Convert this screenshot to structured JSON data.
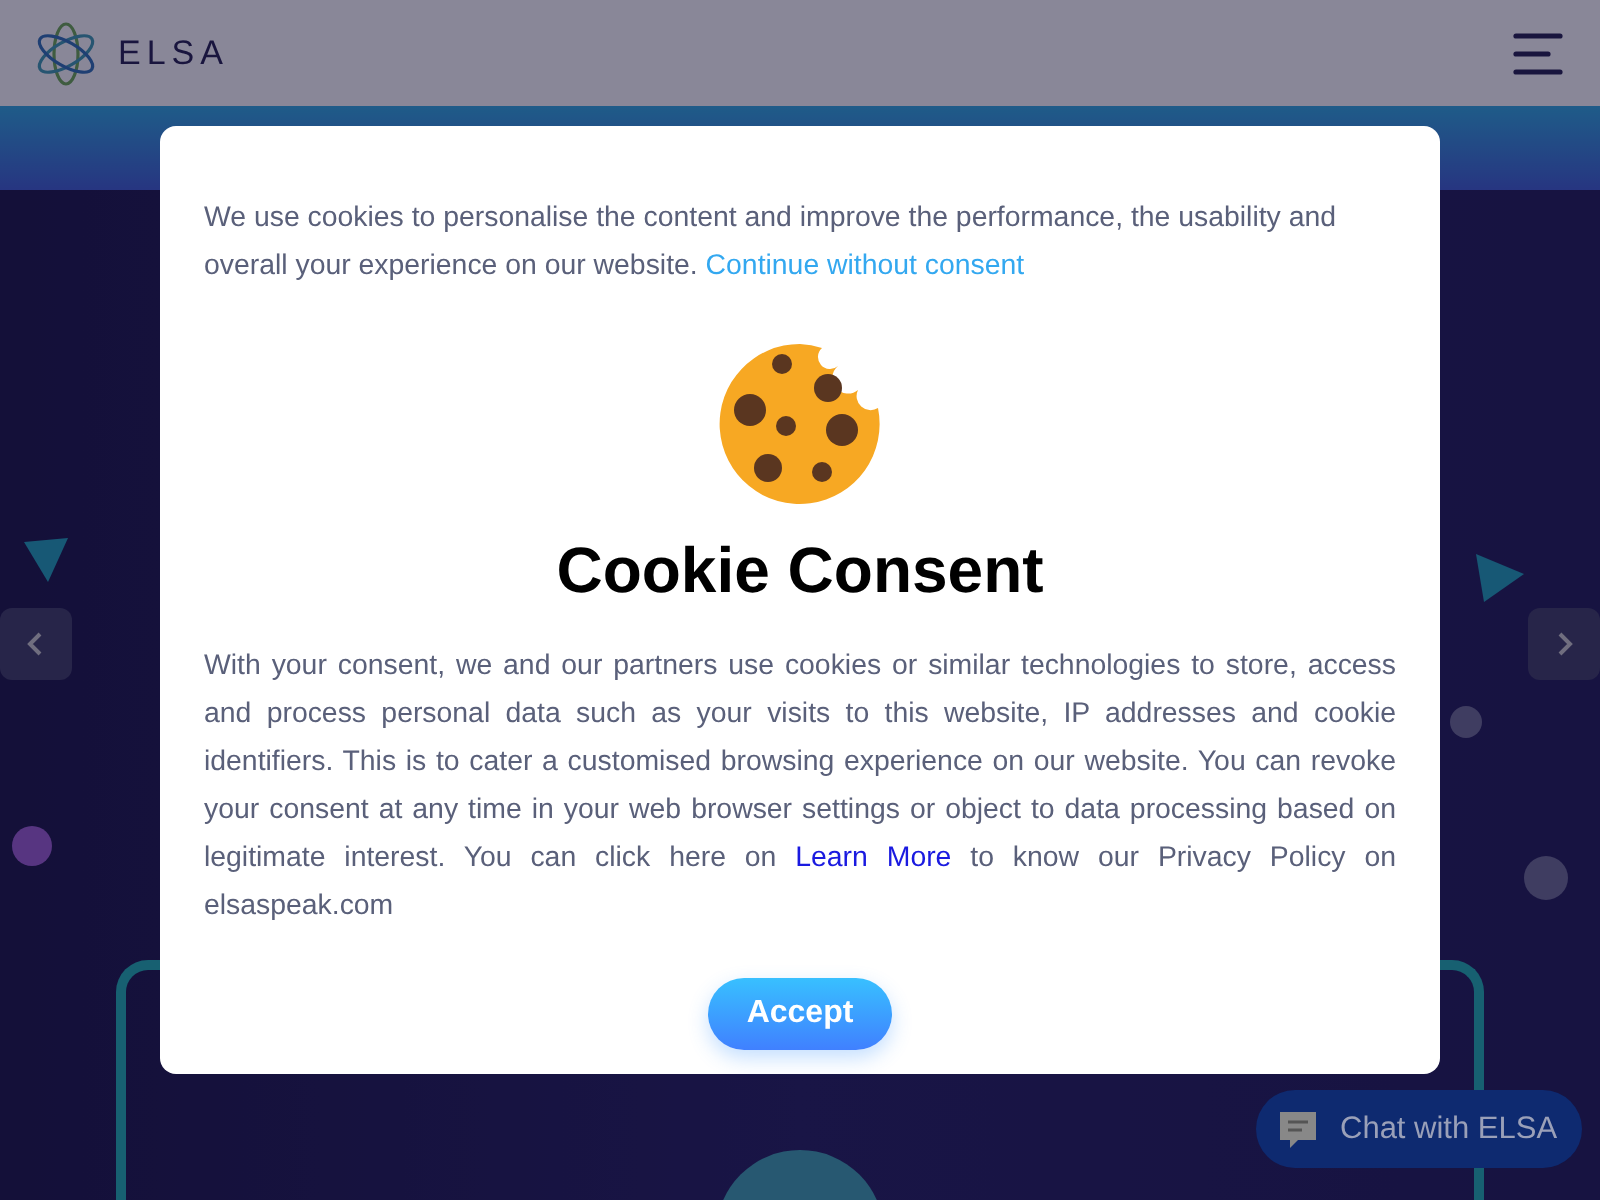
{
  "header": {
    "logo_text": "ELSA"
  },
  "consent": {
    "intro": {
      "text": "We use cookies to personalise the content and improve the performance, the usability and overall your experience on our website.",
      "link": "Continue without consent"
    },
    "title": "Cookie Consent",
    "body": {
      "before": "With your consent, we and our partners use cookies or similar technologies to store, access and process personal data such as your visits to this website, IP addresses and cookie identifiers. This is to cater a customised browsing experience on our website. You can revoke your consent at any time in your web browser settings or object to data processing based on legitimate interest. You can click here on",
      "link": "Learn More",
      "after": "to know our Privacy Policy on elsaspeak.com"
    },
    "button": "Accept"
  },
  "chat": {
    "label": "Chat with ELSA"
  }
}
